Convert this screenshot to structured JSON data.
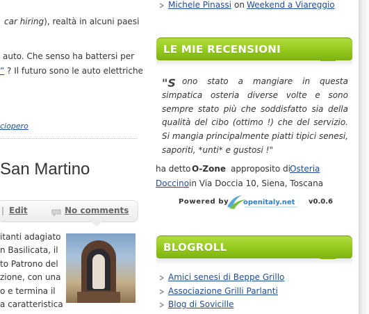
{
  "left": {
    "line1_italic": "car hiring",
    "line1_rest": "), realtà in alcuni paesi",
    "line2": "auto. Che senso ha battersi per",
    "line3_link": "”",
    "line3_rest": " ? Il futuro sono le auto elettriche",
    "category_link": "ciopero",
    "post_title": "San Martino",
    "meta": {
      "separator": "|",
      "edit": "Edit",
      "comments": "No comments"
    },
    "article_lines": [
      "itanti adagiato",
      "n Basilicata, il",
      "to Patrono del",
      "zione, con una",
      "o e termina il",
      "a caratteristica"
    ]
  },
  "sidebar": {
    "top_item": {
      "author": "Michele Pinassi",
      "on": "on",
      "post": "Weekend a Viareggio"
    },
    "reviews": {
      "title": "LE MIE RECENSIONI",
      "quote_mark": "\"S",
      "quote": "ono stato a mangiare in questa simpatica osteria diverse volte e sono sempre stato più che soddisfatto sia della qualità del cibo (ottimo !) che del servizio. Si mangia principalmente piatti tipici senesi, saporiti, *unti* e gustosi !\"",
      "said_by_prefix": "ha detto",
      "reviewer": "O-Zone",
      "about": "approposito di",
      "place_line1": "Osteria",
      "place_line2": "Doccino",
      "address": "in Via Doccia 10, Siena, Toscana",
      "powered_by": "Powered by",
      "logo_text": "openitaly.net",
      "version": "v0.0.6"
    },
    "blogroll": {
      "title": "BLOGROLL",
      "items": [
        "Amici senesi di Beppe Grillo",
        "Associazione Grilli Parlanti",
        "Blog di Sovicille"
      ]
    }
  },
  "colors": {
    "link": "#1d4c9c",
    "widget_green": "#95c91d",
    "text": "#333333"
  }
}
